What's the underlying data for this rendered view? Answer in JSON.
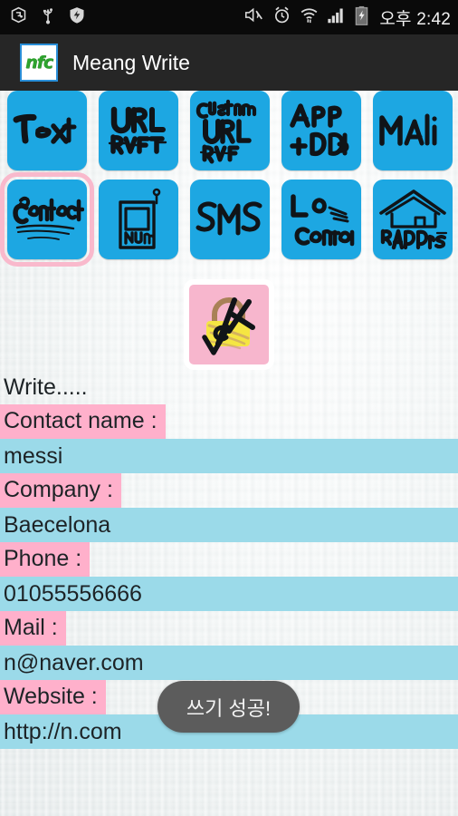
{
  "status_bar": {
    "left_icons": [
      {
        "name": "usb-debug-icon",
        "label": "USB debugging"
      },
      {
        "name": "usb-icon",
        "label": "USB connected"
      },
      {
        "name": "shield-icon",
        "label": "Security shield"
      }
    ],
    "right_icons": [
      {
        "name": "mute-icon",
        "label": "Sound muted"
      },
      {
        "name": "alarm-icon",
        "label": "Alarm set"
      },
      {
        "name": "wifi-icon",
        "label": "Wi-Fi"
      },
      {
        "name": "signal-icon",
        "label": "Cellular signal"
      },
      {
        "name": "battery-charging-icon",
        "label": "Battery charging"
      }
    ],
    "time": "오후 2:42"
  },
  "action_bar": {
    "app_icon_text": "nfc",
    "title": "Meang Write"
  },
  "button_grid": {
    "rows": [
      [
        {
          "id": "text",
          "label": "Text",
          "selected": false
        },
        {
          "id": "url",
          "label": "URL",
          "selected": false
        },
        {
          "id": "custom-url",
          "label": "Custom URL",
          "selected": false
        },
        {
          "id": "app-add",
          "label": "App + Add",
          "selected": false
        },
        {
          "id": "mail",
          "label": "Mail",
          "selected": false
        }
      ],
      [
        {
          "id": "contact",
          "label": "Contact",
          "selected": true
        },
        {
          "id": "number",
          "label": "NuM",
          "selected": false
        },
        {
          "id": "sms",
          "label": "SMS",
          "selected": false
        },
        {
          "id": "location",
          "label": "Location",
          "selected": false
        },
        {
          "id": "address",
          "label": "Address",
          "selected": false
        }
      ]
    ],
    "lock_button": {
      "id": "lock",
      "label": "Lock"
    }
  },
  "form": {
    "heading": "Write.....",
    "fields": [
      {
        "label": "Contact name :",
        "value": "messi"
      },
      {
        "label": "Company :",
        "value": "Baecelona"
      },
      {
        "label": "Phone :",
        "value": "01055556666"
      },
      {
        "label": "Mail :",
        "value": "n@naver.com"
      },
      {
        "label": "Website :",
        "value": "http://n.com"
      }
    ]
  },
  "toast": {
    "message": "쓰기 성공!"
  },
  "colors": {
    "tag_button_blue": "#1da7e2",
    "selected_outline_pink": "#f9b9cc",
    "label_pink": "#ffb0cb",
    "value_blue": "#9bdae9",
    "lock_pink": "#f7b6cd",
    "lock_yellow": "#f5e642",
    "action_bar": "#262626",
    "status_bar": "#0a0a0a",
    "toast_grey": "#5c5c5c"
  }
}
